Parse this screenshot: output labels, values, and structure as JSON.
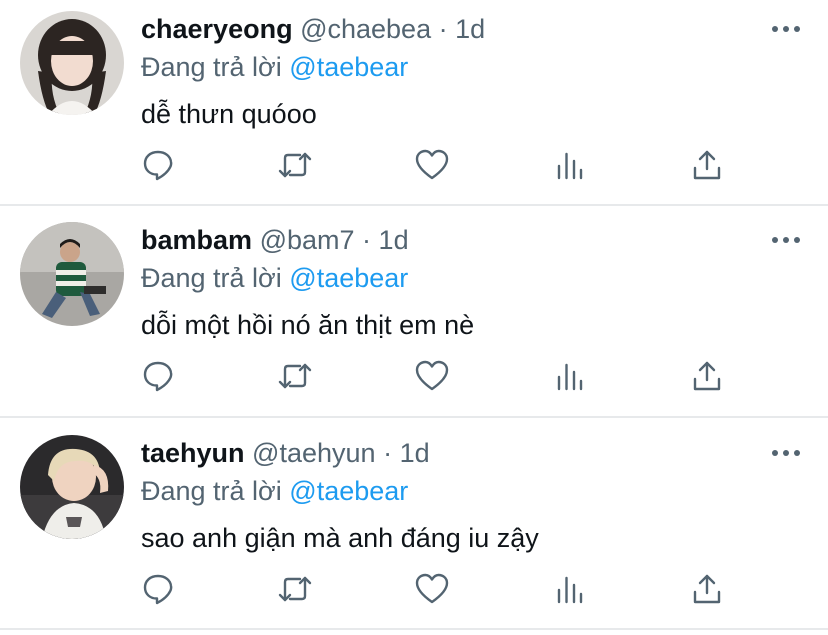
{
  "tweets": [
    {
      "display_name": "chaeryeong",
      "handle": "@chaebea",
      "separator": "·",
      "time": "1d",
      "replying_prefix": "Đang trả lời",
      "replying_to": "@taebear",
      "text": "dễ thưn quóoo",
      "avatar_colors": {
        "bg": "#d9d6d2",
        "hair": "#2c2522",
        "skin": "#f2dcd0",
        "shirt": "#f5f3f0"
      }
    },
    {
      "display_name": "bambam",
      "handle": "@bam7",
      "separator": "·",
      "time": "1d",
      "replying_prefix": "Đang trả lời",
      "replying_to": "@taebear",
      "text": "dỗi một hồi nó ăn thịt em nè",
      "avatar_colors": {
        "bg": "#a9a7a3",
        "hair": "#1f1c1a",
        "skin": "#caa48a",
        "shirt": "#1f5a3d"
      }
    },
    {
      "display_name": "taehyun",
      "handle": "@taehyun",
      "separator": "·",
      "time": "1d",
      "replying_prefix": "Đang trả lời",
      "replying_to": "@taebear",
      "text": "sao anh giận mà anh đáng iu zậy",
      "avatar_colors": {
        "bg": "#2b2a2c",
        "hair": "#e7d9b8",
        "skin": "#efd3c0",
        "shirt": "#efeeea"
      }
    }
  ],
  "actions": [
    "reply-icon",
    "retweet-icon",
    "like-icon",
    "views-icon",
    "share-icon"
  ],
  "colors": {
    "text": "#0f1419",
    "secondary": "#536471",
    "link": "#1d9bf0",
    "divider": "#e7e9eb"
  }
}
